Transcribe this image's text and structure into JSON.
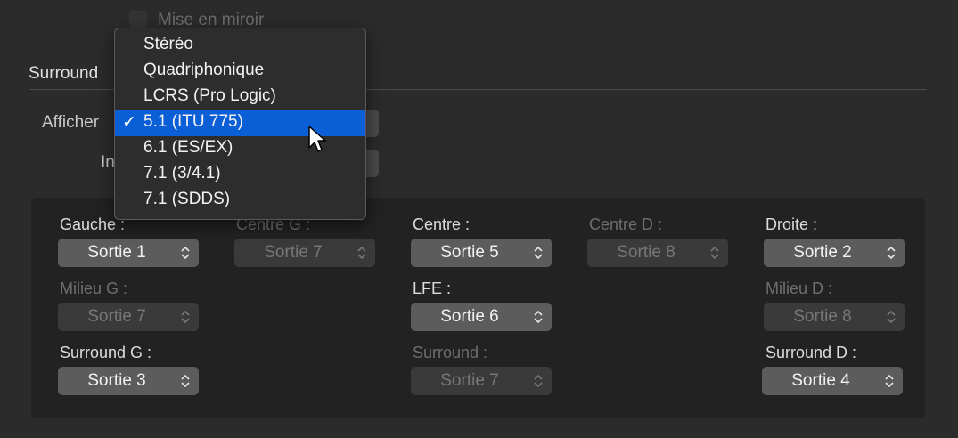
{
  "mirror": {
    "label": "Mise en miroir",
    "checked": false
  },
  "surround": {
    "section_label": "Surround",
    "show_label_partial": "Afficher",
    "input_label_partial": "In"
  },
  "menu": {
    "items": [
      {
        "label": "Stéréo",
        "selected": false
      },
      {
        "label": "Quadriphonique",
        "selected": false
      },
      {
        "label": "LCRS (Pro Logic)",
        "selected": false
      },
      {
        "label": "5.1 (ITU 775)",
        "selected": true
      },
      {
        "label": "6.1 (ES/EX)",
        "selected": false
      },
      {
        "label": "7.1 (3/4.1)",
        "selected": false
      },
      {
        "label": "7.1 (SDDS)",
        "selected": false
      }
    ],
    "check_glyph": "✓"
  },
  "outputs": {
    "left": {
      "label": "Gauche :",
      "value": "Sortie 1"
    },
    "center_left": {
      "label": "Centre G :",
      "value": "Sortie 7"
    },
    "center": {
      "label": "Centre :",
      "value": "Sortie 5"
    },
    "center_right": {
      "label": "Centre D :",
      "value": "Sortie 8"
    },
    "right": {
      "label": "Droite :",
      "value": "Sortie 2"
    },
    "middle_left": {
      "label": "Milieu G :",
      "value": "Sortie 7"
    },
    "lfe": {
      "label": "LFE :",
      "value": "Sortie 6"
    },
    "middle_right": {
      "label": "Milieu D :",
      "value": "Sortie 8"
    },
    "surround_left": {
      "label": "Surround G :",
      "value": "Sortie 3"
    },
    "surround": {
      "label": "Surround :",
      "value": "Sortie 7"
    },
    "surround_right": {
      "label": "Surround D :",
      "value": "Sortie 4"
    }
  },
  "colors": {
    "selection": "#0a5fd6",
    "background": "#2b2b2b",
    "panel": "#222222"
  }
}
